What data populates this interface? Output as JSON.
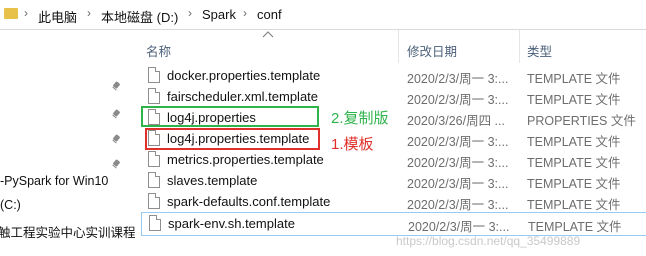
{
  "breadcrumb": {
    "items": [
      "此电脑",
      "本地磁盘 (D:)",
      "Spark",
      "conf"
    ],
    "separator": "›"
  },
  "nav": {
    "items": [
      "-PySpark for Win10",
      "(C:)",
      "触工程实验中心实训课程"
    ]
  },
  "columns": {
    "name": "名称",
    "modified": "修改日期",
    "type": "类型"
  },
  "files": [
    {
      "name": "docker.properties.template",
      "modified": "2020/2/3/周一 3:...",
      "type": "TEMPLATE 文件"
    },
    {
      "name": "fairscheduler.xml.template",
      "modified": "2020/2/3/周一 3:...",
      "type": "TEMPLATE 文件"
    },
    {
      "name": "log4j.properties",
      "modified": "2020/3/26/周四 ...",
      "type": "PROPERTIES 文件"
    },
    {
      "name": "log4j.properties.template",
      "modified": "2020/2/3/周一 3:...",
      "type": "TEMPLATE 文件"
    },
    {
      "name": "metrics.properties.template",
      "modified": "2020/2/3/周一 3:...",
      "type": "TEMPLATE 文件"
    },
    {
      "name": "slaves.template",
      "modified": "2020/2/3/周一 3:...",
      "type": "TEMPLATE 文件"
    },
    {
      "name": "spark-defaults.conf.template",
      "modified": "2020/2/3/周一 3:...",
      "type": "TEMPLATE 文件"
    },
    {
      "name": "spark-env.sh.template",
      "modified": "2020/2/3/周一 3:...",
      "type": "TEMPLATE 文件"
    }
  ],
  "annotations": {
    "green_label": "2.复制版",
    "red_label": "1.模板",
    "green_color": "#2fb34a",
    "red_color": "#e0302a"
  },
  "watermark": "https://blog.csdn.net/qq_35499889"
}
